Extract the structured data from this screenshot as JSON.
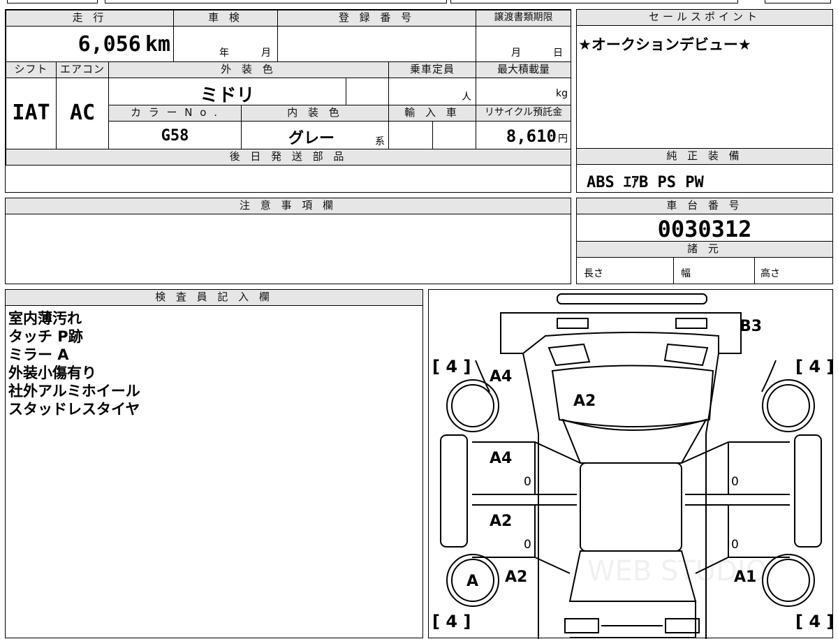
{
  "mileage": {
    "label": "走 行",
    "value": "6,056",
    "unit": "km"
  },
  "inspection": {
    "label": "車 検",
    "year_unit": "年",
    "month_unit": "月"
  },
  "registration": {
    "label": "登 録 番 号"
  },
  "transfer_deadline": {
    "label": "譲渡書類期限",
    "month_unit": "月",
    "day_unit": "日"
  },
  "sales_point": {
    "label": "セールスポイント",
    "value": "★オークションデビュー★"
  },
  "shift": {
    "label": "シフト",
    "value": "IAT"
  },
  "aircon": {
    "label": "エアコン",
    "value": "AC"
  },
  "exterior_color": {
    "label": "外 装 色",
    "value": "ミドリ"
  },
  "capacity": {
    "label": "乗車定員",
    "unit": "人"
  },
  "max_load": {
    "label": "最大積載量",
    "unit": "kg"
  },
  "color_no": {
    "label": "カ ラ ー N o .",
    "value": "G58"
  },
  "interior_color": {
    "label": "内 装 色",
    "value": "グレー",
    "suffix": "系"
  },
  "import": {
    "label": "輸 入 車"
  },
  "recycle": {
    "label": "リサイクル預託金",
    "value": "8,610",
    "unit": "円"
  },
  "later_parts": {
    "label": "後 日 発 送 部 品"
  },
  "genuine_equipment": {
    "label": "純 正 装 備",
    "value": "ABS ｴｱB PS PW"
  },
  "notes_section": {
    "label": "注 意 事 項 欄"
  },
  "chassis_no": {
    "label": "車 台 番 号",
    "value": "0030312"
  },
  "specs": {
    "label": "諸 元",
    "length": "長さ",
    "width": "幅",
    "height": "高さ"
  },
  "inspector": {
    "label": "検 査 員 記 入 欄",
    "notes": [
      "室内薄汚れ",
      "タッチ P跡",
      "ミラー A",
      "外装小傷有り",
      "社外アルミホイール",
      "スタッドレスタイヤ"
    ]
  },
  "diagram": {
    "tread": {
      "front_left": "[ 4 ]",
      "front_right": "[ 4 ]",
      "rear_left": "[ 4 ]",
      "rear_right": "[ 4 ]"
    },
    "marks": {
      "rear_bumper": "B3",
      "rear_door_left": "A4",
      "roof": "A2",
      "left_rear_door": "A4",
      "left_front_door": "A2",
      "left_fender": "A2",
      "right_fender": "A1",
      "left_front_wheel": "A"
    },
    "zeros": [
      "0",
      "0",
      "0",
      "0"
    ],
    "watermark": "WEB STUDIO"
  }
}
